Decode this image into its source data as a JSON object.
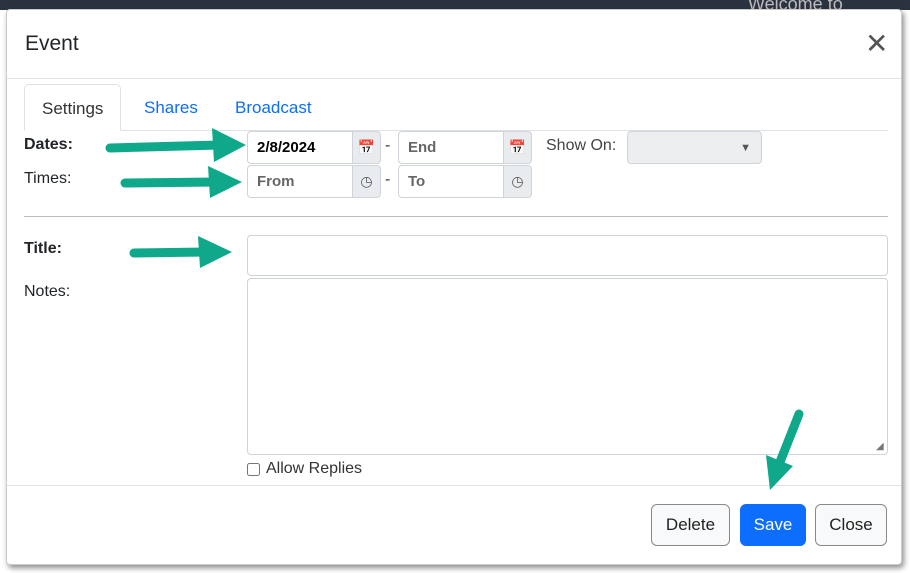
{
  "background": {
    "text": "Welcome to"
  },
  "modal": {
    "title": "Event",
    "close_icon": "close-x-icon"
  },
  "tabs": [
    {
      "label": "Settings",
      "active": true
    },
    {
      "label": "Shares"
    },
    {
      "label": "Broadcast"
    }
  ],
  "form": {
    "dates_label": "Dates:",
    "times_label": "Times:",
    "start_date": "2/8/2024",
    "end_date_placeholder": "End",
    "from_placeholder": "From",
    "to_placeholder": "To",
    "dash": "-",
    "show_on_label": "Show On:",
    "show_on_value": "",
    "title_label": "Title:",
    "title_value": "",
    "notes_label": "Notes:",
    "notes_value": "",
    "allow_replies_label": "Allow Replies",
    "allow_replies_checked": false
  },
  "footer": {
    "delete": "Delete",
    "save": "Save",
    "close": "Close"
  },
  "colors": {
    "accent": "#0d6efd",
    "annotation_arrow": "#10a88a"
  }
}
